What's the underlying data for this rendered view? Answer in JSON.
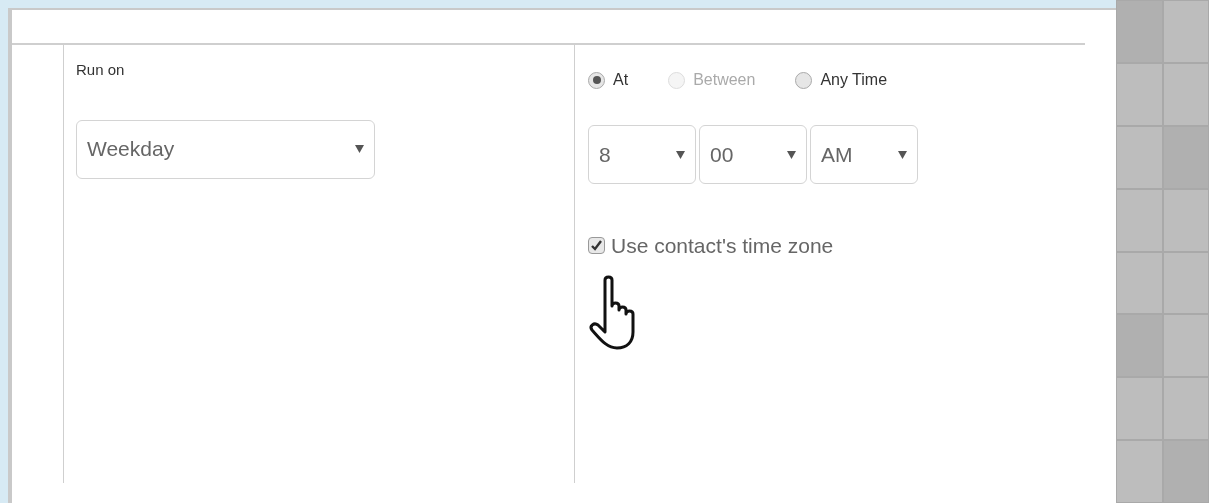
{
  "run_on": {
    "label": "Run on",
    "select": {
      "value": "Weekday"
    }
  },
  "time_mode": [
    {
      "label": "At",
      "selected": true,
      "disabled": false
    },
    {
      "label": "Between",
      "selected": false,
      "disabled": true
    },
    {
      "label": "Any Time",
      "selected": false,
      "disabled": false
    }
  ],
  "time_selects": [
    {
      "value": "8"
    },
    {
      "value": "00"
    },
    {
      "value": "AM"
    }
  ],
  "timezone_checkbox": {
    "label": "Use contact's time zone",
    "checked": true
  }
}
